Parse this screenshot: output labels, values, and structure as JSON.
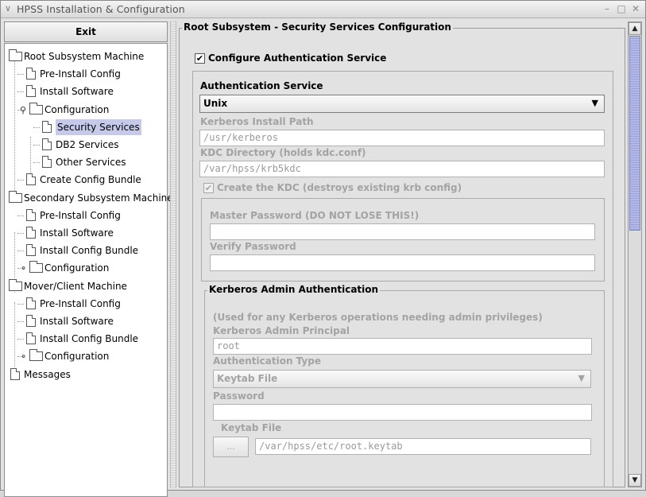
{
  "window": {
    "title": "HPSS Installation & Configuration",
    "menu_glyph": "∨",
    "min_glyph": "–",
    "max_glyph": "□",
    "close_glyph": "✕"
  },
  "sidebar": {
    "exit_label": "Exit",
    "tree": [
      {
        "label": "Root Subsystem Machine",
        "type": "folder"
      },
      {
        "label": "Pre-Install Config",
        "type": "doc"
      },
      {
        "label": "Install Software",
        "type": "doc"
      },
      {
        "label": "Configuration",
        "type": "folder",
        "toggle": "⚲"
      },
      {
        "label": "Security Services",
        "type": "doc",
        "selected": true
      },
      {
        "label": "DB2 Services",
        "type": "doc"
      },
      {
        "label": "Other Services",
        "type": "doc"
      },
      {
        "label": "Create Config Bundle",
        "type": "doc"
      },
      {
        "label": "Secondary Subsystem Machine",
        "type": "folder"
      },
      {
        "label": "Pre-Install Config",
        "type": "doc"
      },
      {
        "label": "Install Software",
        "type": "doc"
      },
      {
        "label": "Install Config Bundle",
        "type": "doc"
      },
      {
        "label": "Configuration",
        "type": "folder",
        "toggle": "⚬"
      },
      {
        "label": "Mover/Client Machine",
        "type": "folder"
      },
      {
        "label": "Pre-Install Config",
        "type": "doc"
      },
      {
        "label": "Install Software",
        "type": "doc"
      },
      {
        "label": "Install Config Bundle",
        "type": "doc"
      },
      {
        "label": "Configuration",
        "type": "folder",
        "toggle": "⚬"
      },
      {
        "label": "Messages",
        "type": "doc"
      }
    ]
  },
  "main": {
    "section_title": "Root Subsystem - Security Services Configuration",
    "configure_auth": {
      "label": "Configure Authentication Service",
      "checked": true,
      "mark": "✔"
    },
    "auth_service": {
      "title": "Authentication Service",
      "selected": "Unix",
      "kerberos_path_label": "Kerberos Install Path",
      "kerberos_path_value": "/usr/kerberos",
      "kdc_dir_label": "KDC Directory (holds kdc.conf)",
      "kdc_dir_value": "/var/hpss/krb5kdc",
      "create_kdc_label": "Create the KDC (destroys existing krb config)",
      "create_kdc_mark": "✔",
      "master_pw_label": "Master Password (DO NOT LOSE THIS!)",
      "master_pw_value": "",
      "verify_pw_label": "Verify Password",
      "verify_pw_value": ""
    },
    "kerberos_admin": {
      "title": "Kerberos Admin Authentication",
      "note": "(Used for any Kerberos operations needing admin privileges)",
      "principal_label": "Kerberos Admin Principal",
      "principal_value": "root",
      "auth_type_label": "Authentication Type",
      "auth_type_value": "Keytab File",
      "password_label": "Password",
      "password_value": "",
      "keytab_label": "Keytab File",
      "keytab_button": "...",
      "keytab_value": "/var/hpss/etc/root.keytab"
    }
  },
  "scrollbar": {
    "up_glyph": "▲",
    "down_glyph": "▼"
  }
}
